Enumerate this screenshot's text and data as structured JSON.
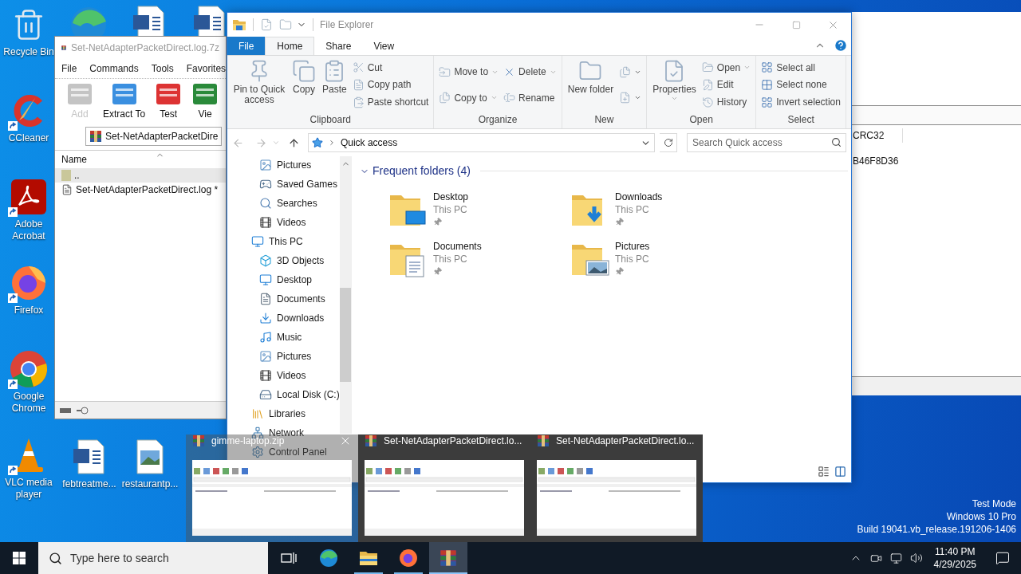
{
  "desktop": {
    "icons_column": [
      {
        "kind": "recycle",
        "label": "Recycle Bin",
        "shortcut": false
      },
      {
        "kind": "ccleaner",
        "label": "CCleaner",
        "shortcut": true
      },
      {
        "kind": "acrobat",
        "label": "Adobe Acrobat",
        "shortcut": true
      },
      {
        "kind": "firefox",
        "label": "Firefox",
        "shortcut": true
      },
      {
        "kind": "chrome",
        "label": "Google Chrome",
        "shortcut": true
      },
      {
        "kind": "vlc",
        "label": "VLC media player",
        "shortcut": true
      }
    ],
    "icons_top": [
      {
        "kind": "edge"
      },
      {
        "kind": "word"
      },
      {
        "kind": "word"
      }
    ],
    "icons_bottom": [
      {
        "kind": "word",
        "label": "febtreatme..."
      },
      {
        "kind": "image",
        "label": "restaurantp..."
      }
    ],
    "system_notice": [
      "Test Mode",
      "Windows 10 Pro",
      "Build 19041.vb_release.191206-1406"
    ]
  },
  "back_window": {
    "columns": [
      "CRC32"
    ],
    "rows": [
      "B46F8D36"
    ]
  },
  "winrar_window": {
    "title": "Set-NetAdapterPacketDirect.log.7z",
    "menu": [
      "File",
      "Commands",
      "Tools",
      "Favorites"
    ],
    "toolbar": [
      {
        "label": "Add",
        "kind": "add",
        "disabled": true
      },
      {
        "label": "Extract To",
        "kind": "extract",
        "disabled": false
      },
      {
        "label": "Test",
        "kind": "test",
        "disabled": false
      },
      {
        "label": "Vie",
        "kind": "view",
        "disabled": false
      }
    ],
    "path": "Set-NetAdapterPacketDire",
    "columns": [
      "Name"
    ],
    "rows": [
      {
        "name": "..",
        "kind": "up",
        "selected": true
      },
      {
        "name": "Set-NetAdapterPacketDirect.log *",
        "kind": "file",
        "selected": false
      }
    ]
  },
  "explorer": {
    "title": "File Explorer",
    "tabs": [
      {
        "label": "File",
        "kind": "file",
        "selected": false
      },
      {
        "label": "Home",
        "kind": "tab",
        "selected": true
      },
      {
        "label": "Share",
        "kind": "tab",
        "selected": false
      },
      {
        "label": "View",
        "kind": "tab",
        "selected": false
      }
    ],
    "ribbon": [
      {
        "label": "Clipboard",
        "columns": [
          {
            "kind": "large",
            "buttons": [
              {
                "label": "Pin to Quick access",
                "kind": "pin",
                "menu": false
              },
              {
                "label": "Copy",
                "kind": "copy",
                "menu": false
              },
              {
                "label": "Paste",
                "kind": "paste",
                "menu": false
              }
            ]
          },
          {
            "kind": "small",
            "buttons": [
              {
                "label": "Cut",
                "kind": "cut",
                "menu": false
              },
              {
                "label": "Copy path",
                "kind": "copy-path",
                "menu": false
              },
              {
                "label": "Paste shortcut",
                "kind": "paste-shortcut",
                "menu": false
              }
            ]
          }
        ]
      },
      {
        "label": "Organize",
        "columns": [
          {
            "kind": "small",
            "buttons": [
              {
                "label": "Move to",
                "kind": "move",
                "menu": true
              },
              {
                "label": "Copy to",
                "kind": "copy-to",
                "menu": true
              }
            ]
          },
          {
            "kind": "small",
            "buttons": [
              {
                "label": "Delete",
                "kind": "delete",
                "menu": true
              },
              {
                "label": "Rename",
                "kind": "rename",
                "menu": false
              }
            ]
          }
        ]
      },
      {
        "label": "New",
        "columns": [
          {
            "kind": "large",
            "buttons": [
              {
                "label": "New folder",
                "kind": "new-folder",
                "menu": false
              }
            ]
          },
          {
            "kind": "small",
            "buttons": [
              {
                "kind": "easy-access",
                "menu": true
              },
              {
                "kind": "new-item",
                "menu": true
              }
            ]
          }
        ]
      },
      {
        "label": "Open",
        "columns": [
          {
            "kind": "large",
            "buttons": [
              {
                "label": "Properties",
                "kind": "properties",
                "menu": true
              }
            ]
          },
          {
            "kind": "small",
            "buttons": [
              {
                "label": "Open",
                "kind": "open",
                "menu": true
              },
              {
                "label": "Edit",
                "kind": "edit",
                "menu": false
              },
              {
                "label": "History",
                "kind": "history",
                "menu": false
              }
            ]
          }
        ]
      },
      {
        "label": "Select",
        "columns": [
          {
            "kind": "small",
            "buttons": [
              {
                "label": "Select all",
                "kind": "select-all",
                "menu": false
              },
              {
                "label": "Select none",
                "kind": "select-none",
                "menu": false
              },
              {
                "label": "Invert selection",
                "kind": "invert",
                "menu": false
              }
            ]
          }
        ]
      }
    ],
    "address": "Quick access",
    "search_placeholder": "Search Quick access",
    "navigation": {
      "continued": [
        {
          "label": "Pictures",
          "kind": "pictures"
        },
        {
          "label": "Saved Games",
          "kind": "games"
        },
        {
          "label": "Searches",
          "kind": "search"
        },
        {
          "label": "Videos",
          "kind": "videos"
        }
      ],
      "items": [
        {
          "label": "This PC",
          "kind": "pc",
          "children": [
            {
              "label": "3D Objects",
              "kind": "cube"
            },
            {
              "label": "Desktop",
              "kind": "desktop"
            },
            {
              "label": "Documents",
              "kind": "documents"
            },
            {
              "label": "Downloads",
              "kind": "downloads"
            },
            {
              "label": "Music",
              "kind": "music"
            },
            {
              "label": "Pictures",
              "kind": "pictures"
            },
            {
              "label": "Videos",
              "kind": "videos"
            },
            {
              "label": "Local Disk (C:)",
              "kind": "disk"
            }
          ]
        },
        {
          "label": "Libraries",
          "kind": "libraries"
        },
        {
          "label": "Network",
          "kind": "network"
        },
        {
          "label": "Control Panel",
          "kind": "control"
        }
      ]
    },
    "section": {
      "title": "Frequent folders (4)",
      "expanded": true,
      "folders": [
        {
          "name": "Desktop",
          "location": "This PC",
          "kind": "desktop"
        },
        {
          "name": "Downloads",
          "location": "This PC",
          "kind": "downloads"
        },
        {
          "name": "Documents",
          "location": "This PC",
          "kind": "documents"
        },
        {
          "name": "Pictures",
          "location": "This PC",
          "kind": "pictures"
        }
      ]
    }
  },
  "previews": [
    {
      "title": "gimme-laptop.zip",
      "selected": true
    },
    {
      "title": "Set-NetAdapterPacketDirect.lo...",
      "selected": false
    },
    {
      "title": "Set-NetAdapterPacketDirect.lo...",
      "selected": false
    }
  ],
  "taskbar": {
    "search_placeholder": "Type here to search",
    "apps": [
      {
        "kind": "task-view",
        "running": false,
        "selected": false
      },
      {
        "kind": "edge",
        "running": false,
        "selected": false
      },
      {
        "kind": "explorer",
        "running": true,
        "selected": false
      },
      {
        "kind": "firefox",
        "running": true,
        "selected": false
      },
      {
        "kind": "winrar",
        "running": true,
        "selected": true
      }
    ],
    "time": "11:40 PM",
    "date": "4/29/2025"
  }
}
